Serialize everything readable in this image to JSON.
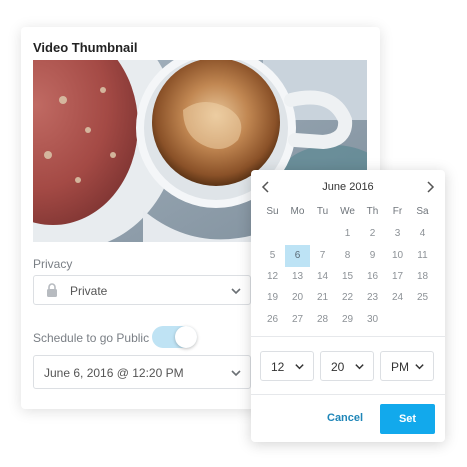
{
  "card": {
    "title": "Video Thumbnail",
    "privacy": {
      "label": "Privacy",
      "value": "Private",
      "icon": "lock-icon"
    },
    "schedule": {
      "label": "Schedule to go Public",
      "toggle_on": true
    },
    "datetime": {
      "value": "June 6, 2016 @ 12:20 PM"
    }
  },
  "picker": {
    "month_title": "June 2016",
    "weekdays": [
      "Su",
      "Mo",
      "Tu",
      "We",
      "Th",
      "Fr",
      "Sa"
    ],
    "weeks": [
      [
        "",
        "",
        "",
        "1",
        "2",
        "3",
        "4"
      ],
      [
        "5",
        "6",
        "7",
        "8",
        "9",
        "10",
        "11"
      ],
      [
        "12",
        "13",
        "14",
        "15",
        "16",
        "17",
        "18"
      ],
      [
        "19",
        "20",
        "21",
        "22",
        "23",
        "24",
        "25"
      ],
      [
        "26",
        "27",
        "28",
        "29",
        "30",
        "",
        ""
      ]
    ],
    "selected_day": "6",
    "time": {
      "hour": "12",
      "minute": "20",
      "ampm": "PM"
    },
    "cancel_label": "Cancel",
    "set_label": "Set"
  },
  "colors": {
    "accent": "#12a9ec",
    "selected_day_bg": "#bde3f5",
    "toggle_track": "#bfe3f4"
  }
}
